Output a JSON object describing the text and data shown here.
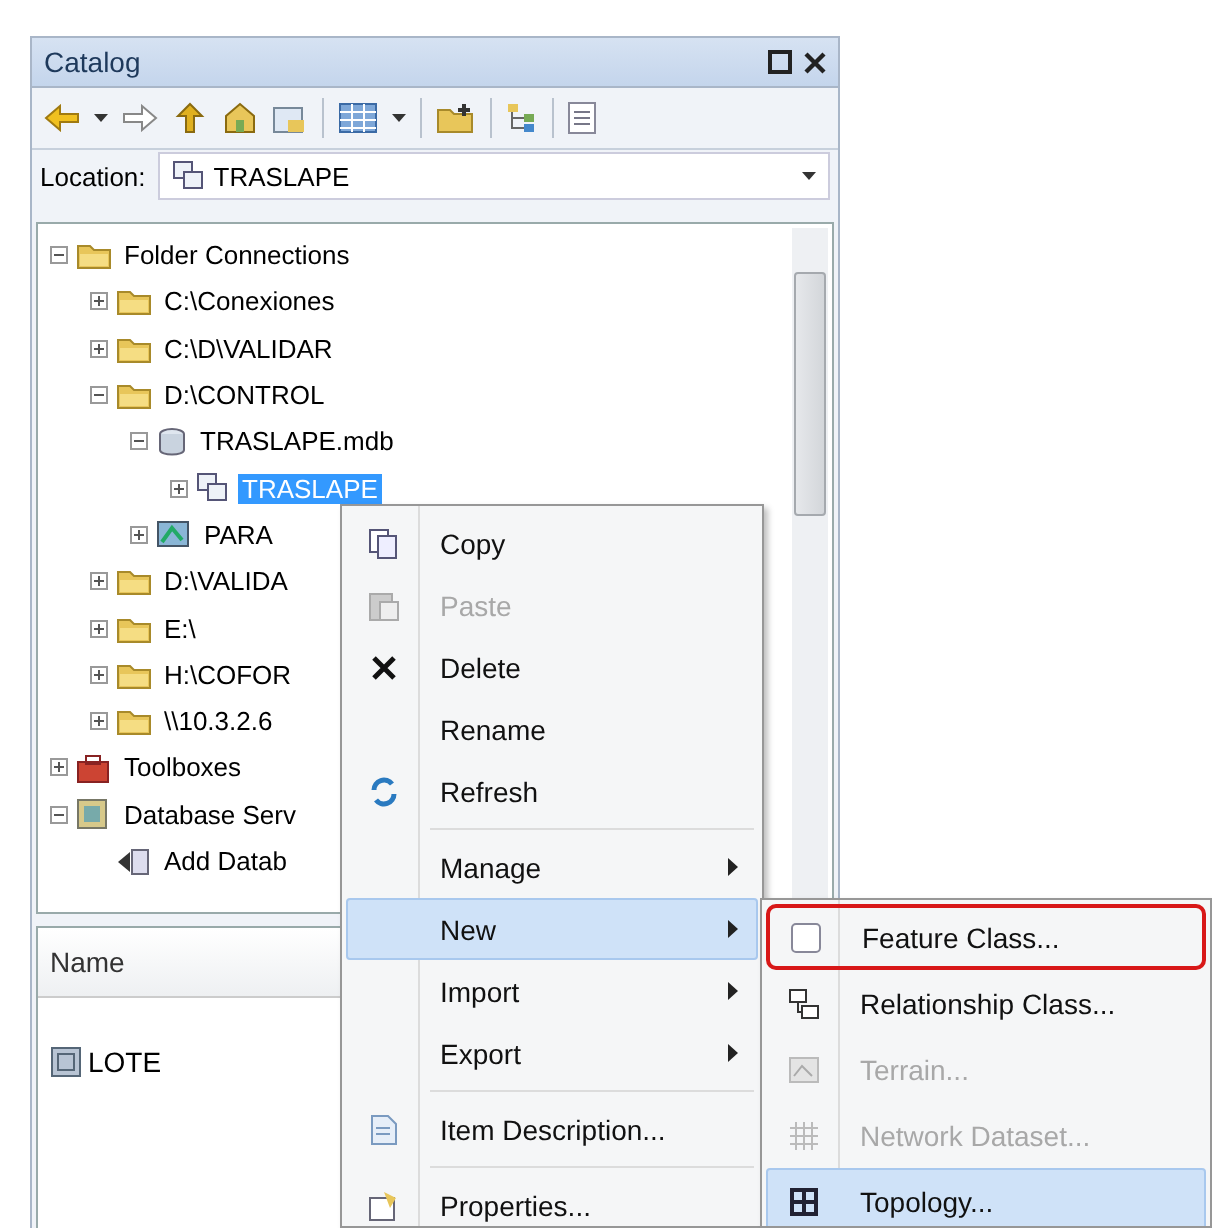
{
  "window": {
    "title": "Catalog"
  },
  "location": {
    "label": "Location:",
    "value": "TRASLAPE"
  },
  "tree": [
    {
      "label": "Folder Connections",
      "kind": "folder",
      "expanded": true,
      "selected": false,
      "children": [
        {
          "label": "C:\\Conexiones",
          "kind": "folder",
          "expanded": false,
          "selected": false
        },
        {
          "label": "C:\\D\\VALIDAR",
          "kind": "folder",
          "expanded": false,
          "selected": false
        },
        {
          "label": "D:\\CONTROL",
          "kind": "folder",
          "expanded": true,
          "selected": false,
          "children": [
            {
              "label": "TRASLAPE.mdb",
              "kind": "database",
              "expanded": true,
              "selected": false,
              "children": [
                {
                  "label": "TRASLAPE",
                  "kind": "dataset",
                  "expanded": false,
                  "selected": true
                }
              ]
            },
            {
              "label": "PARA",
              "kind": "network",
              "expanded": false,
              "selected": false
            }
          ]
        },
        {
          "label": "D:\\VALIDA",
          "kind": "folder",
          "expanded": false,
          "selected": false
        },
        {
          "label": "E:\\",
          "kind": "folder",
          "expanded": false,
          "selected": false
        },
        {
          "label": "H:\\COFOR",
          "kind": "folder",
          "expanded": false,
          "selected": false
        },
        {
          "label": "\\\\10.3.2.6",
          "kind": "folder",
          "expanded": false,
          "selected": false
        }
      ]
    },
    {
      "label": "Toolboxes",
      "kind": "toolbox",
      "expanded": false,
      "selected": false
    },
    {
      "label": "Database Serv",
      "kind": "server",
      "expanded": true,
      "selected": false,
      "children": [
        {
          "label": "Add Datab",
          "kind": "action",
          "selected": false
        }
      ]
    }
  ],
  "contents": {
    "column": "Name",
    "items": [
      "LOTE"
    ]
  },
  "context_menu": [
    {
      "kind": "command",
      "label": "Copy",
      "disabled": false,
      "highlighted": false
    },
    {
      "kind": "command",
      "label": "Paste",
      "disabled": true,
      "highlighted": false
    },
    {
      "kind": "command",
      "label": "Delete",
      "disabled": false,
      "highlighted": false
    },
    {
      "kind": "command",
      "label": "Rename",
      "disabled": false,
      "highlighted": false
    },
    {
      "kind": "command",
      "label": "Refresh",
      "disabled": false,
      "highlighted": false
    },
    {
      "kind": "separator"
    },
    {
      "kind": "submenu",
      "label": "Manage",
      "disabled": false,
      "highlighted": false
    },
    {
      "kind": "submenu",
      "label": "New",
      "disabled": false,
      "highlighted": true
    },
    {
      "kind": "submenu",
      "label": "Import",
      "disabled": false,
      "highlighted": false
    },
    {
      "kind": "submenu",
      "label": "Export",
      "disabled": false,
      "highlighted": false
    },
    {
      "kind": "separator"
    },
    {
      "kind": "command",
      "label": "Item Description...",
      "disabled": false,
      "highlighted": false
    },
    {
      "kind": "separator"
    },
    {
      "kind": "command",
      "label": "Properties...",
      "disabled": false,
      "highlighted": false
    }
  ],
  "submenu": [
    {
      "label": "Feature Class...",
      "disabled": false,
      "highlighted": false,
      "outlined": true
    },
    {
      "label": "Relationship Class...",
      "disabled": false,
      "highlighted": false,
      "outlined": false
    },
    {
      "label": "Terrain...",
      "disabled": true,
      "highlighted": false,
      "outlined": false
    },
    {
      "label": "Network Dataset...",
      "disabled": true,
      "highlighted": false,
      "outlined": false
    },
    {
      "label": "Topology...",
      "disabled": false,
      "highlighted": true,
      "outlined": false
    }
  ]
}
